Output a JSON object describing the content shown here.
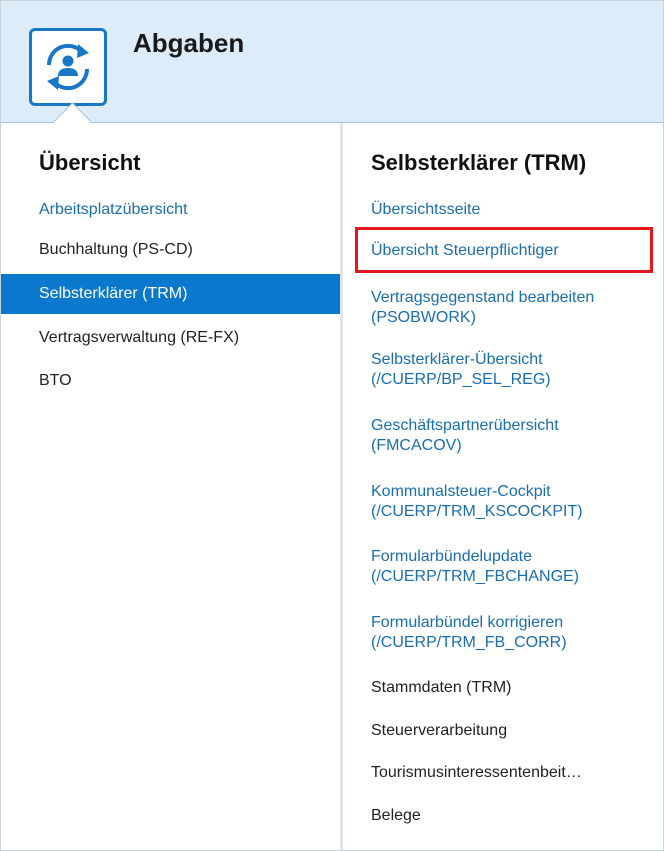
{
  "app": {
    "title": "Abgaben",
    "icon": "user-cycle-icon"
  },
  "left": {
    "heading": "Übersicht",
    "items": [
      {
        "label": "Arbeitsplatzübersicht",
        "state": "link"
      },
      {
        "label": "Buchhaltung (PS-CD)",
        "state": "normal"
      },
      {
        "label": "Selbsterklärer (TRM)",
        "state": "selected"
      },
      {
        "label": "Vertragsverwaltung (RE-FX)",
        "state": "normal"
      },
      {
        "label": "BTO",
        "state": "normal"
      }
    ]
  },
  "right": {
    "heading": "Selbsterklärer (TRM)",
    "items": [
      {
        "line1": "Übersichtsseite",
        "line2": "",
        "type": "link"
      },
      {
        "line1": "Übersicht Steuerpflichtiger",
        "line2": "",
        "type": "link",
        "highlighted": true
      },
      {
        "line1": "Vertragsgegenstand bearbeiten",
        "line2": "(PSOBWORK)",
        "type": "link"
      },
      {
        "line1": "Selbsterklärer-Übersicht",
        "line2": "(/CUERP/BP_SEL_REG)",
        "type": "link"
      },
      {
        "line1": "Geschäftspartnerübersicht",
        "line2": "(FMCACOV)",
        "type": "link"
      },
      {
        "line1": "Kommunalsteuer-Cockpit",
        "line2": "(/CUERP/TRM_KSCOCKPIT)",
        "type": "link"
      },
      {
        "line1": "Formularbündelupdate",
        "line2": "(/CUERP/TRM_FBCHANGE)",
        "type": "link"
      },
      {
        "line1": "Formularbündel korrigieren",
        "line2": "(/CUERP/TRM_FB_CORR)",
        "type": "link"
      },
      {
        "line1": "Stammdaten (TRM)",
        "line2": "",
        "type": "plain"
      },
      {
        "line1": "Steuerverarbeitung",
        "line2": "",
        "type": "plain"
      },
      {
        "line1": "Tourismusinteressentenbeit…",
        "line2": "",
        "type": "plain"
      },
      {
        "line1": "Belege",
        "line2": "",
        "type": "plain"
      }
    ]
  },
  "colors": {
    "header_bg": "#dcecf8",
    "accent": "#1877c6",
    "selected_bg": "#0a78cc",
    "link": "#1a6db0",
    "highlight_border": "#e3171d"
  }
}
